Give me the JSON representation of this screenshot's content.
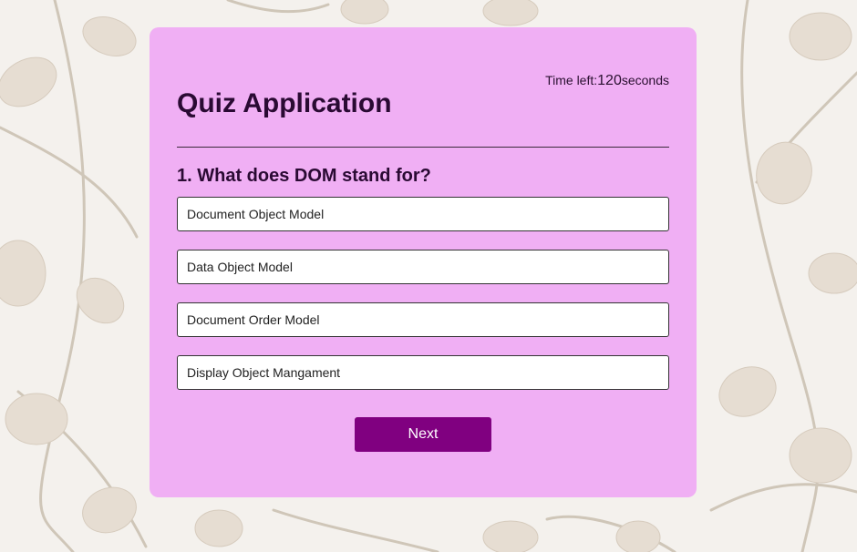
{
  "header": {
    "title": "Quiz Application",
    "timer_prefix": "Time left:",
    "timer_value": "120",
    "timer_suffix": "seconds"
  },
  "quiz": {
    "question": "1. What does DOM stand for?",
    "options": [
      "Document Object Model",
      "Data Object Model",
      "Document Order Model",
      "Display Object Mangament"
    ],
    "next_label": "Next"
  },
  "colors": {
    "card_background": "#f0aff4",
    "button_background": "#800080",
    "text_dark": "#2a0a33"
  }
}
